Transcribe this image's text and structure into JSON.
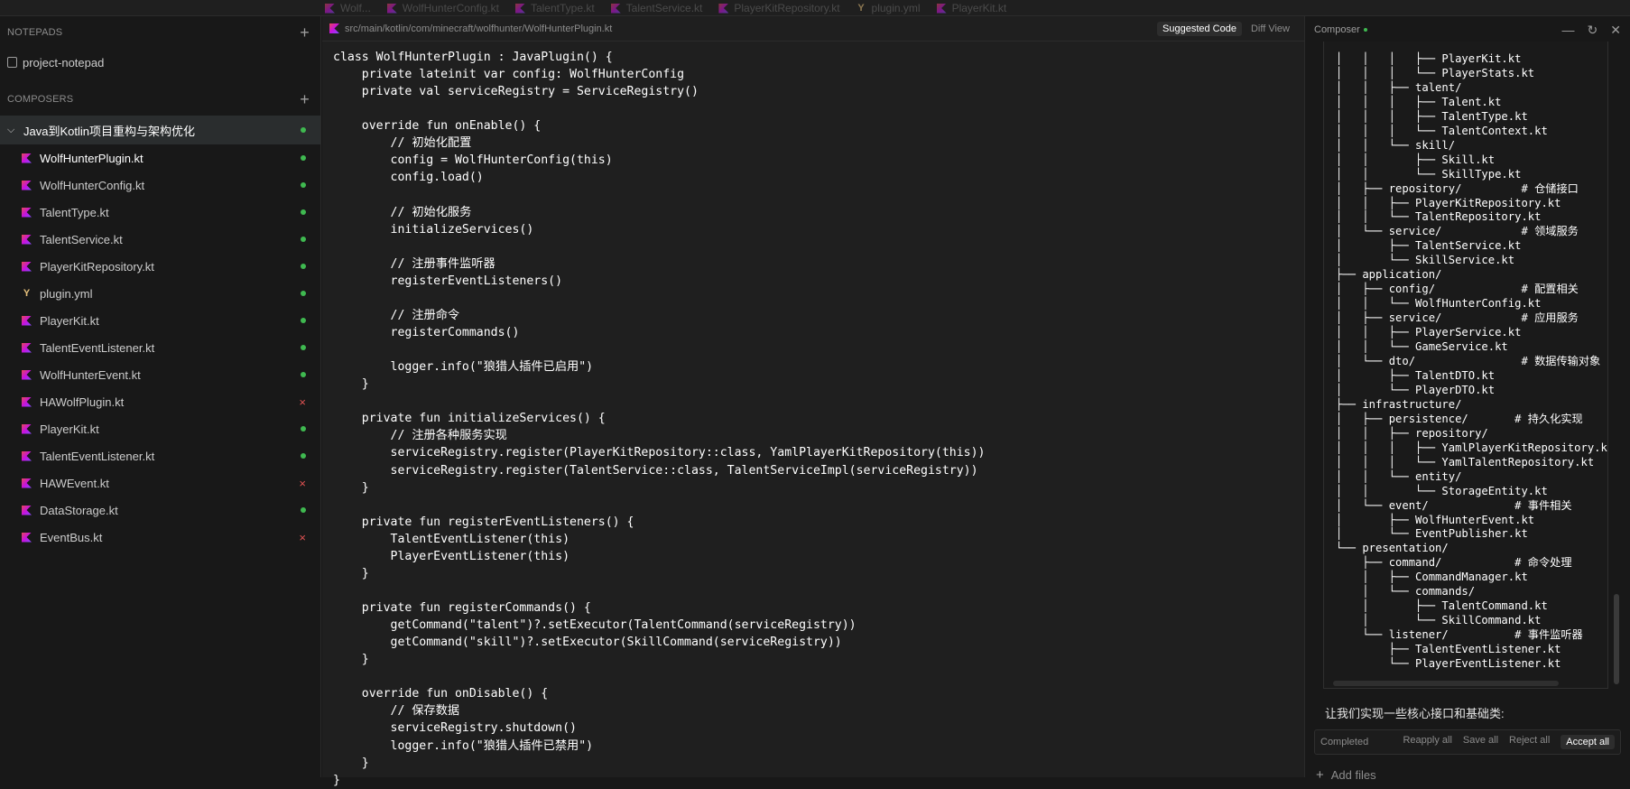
{
  "top_tabs": [
    "Wolf...",
    "WolfHunterConfig.kt",
    "TalentType.kt",
    "TalentService.kt",
    "PlayerKitRepository.kt",
    "plugin.yml",
    "PlayerKit.kt"
  ],
  "sidebar": {
    "notepads_label": "NOTEPADS",
    "notepad_item": "project-notepad",
    "composers_label": "COMPOSERS",
    "composer_title": "Java到Kotlin项目重构与架构优化",
    "files": [
      {
        "name": "WolfHunterPlugin.kt",
        "type": "kt",
        "status": "ok"
      },
      {
        "name": "WolfHunterConfig.kt",
        "type": "kt",
        "status": "ok"
      },
      {
        "name": "TalentType.kt",
        "type": "kt",
        "status": "ok"
      },
      {
        "name": "TalentService.kt",
        "type": "kt",
        "status": "ok"
      },
      {
        "name": "PlayerKitRepository.kt",
        "type": "kt",
        "status": "ok"
      },
      {
        "name": "plugin.yml",
        "type": "yml",
        "status": "ok"
      },
      {
        "name": "PlayerKit.kt",
        "type": "kt",
        "status": "ok"
      },
      {
        "name": "TalentEventListener.kt",
        "type": "kt",
        "status": "ok"
      },
      {
        "name": "WolfHunterEvent.kt",
        "type": "kt",
        "status": "ok"
      },
      {
        "name": "HAWolfPlugin.kt",
        "type": "kt",
        "status": "err"
      },
      {
        "name": "PlayerKit.kt",
        "type": "kt",
        "status": "ok"
      },
      {
        "name": "TalentEventListener.kt",
        "type": "kt",
        "status": "ok"
      },
      {
        "name": "HAWEvent.kt",
        "type": "kt",
        "status": "err"
      },
      {
        "name": "DataStorage.kt",
        "type": "kt",
        "status": "ok"
      },
      {
        "name": "EventBus.kt",
        "type": "kt",
        "status": "err"
      }
    ]
  },
  "editor": {
    "path": "src/main/kotlin/com/minecraft/wolfhunter/WolfHunterPlugin.kt",
    "suggested_label": "Suggested Code",
    "diff_label": "Diff View",
    "code_lines": [
      "class WolfHunterPlugin : JavaPlugin() {",
      "    private lateinit var config: WolfHunterConfig",
      "    private val serviceRegistry = ServiceRegistry()",
      "",
      "    override fun onEnable() {",
      "        // 初始化配置",
      "        config = WolfHunterConfig(this)",
      "        config.load()",
      "",
      "        // 初始化服务",
      "        initializeServices()",
      "",
      "        // 注册事件监听器",
      "        registerEventListeners()",
      "",
      "        // 注册命令",
      "        registerCommands()",
      "",
      "        logger.info(\"狼猎人插件已启用\")",
      "    }",
      "",
      "    private fun initializeServices() {",
      "        // 注册各种服务实现",
      "        serviceRegistry.register(PlayerKitRepository::class, YamlPlayerKitRepository(this))",
      "        serviceRegistry.register(TalentService::class, TalentServiceImpl(serviceRegistry))",
      "    }",
      "",
      "    private fun registerEventListeners() {",
      "        TalentEventListener(this)",
      "        PlayerEventListener(this)",
      "    }",
      "",
      "    private fun registerCommands() {",
      "        getCommand(\"talent\")?.setExecutor(TalentCommand(serviceRegistry))",
      "        getCommand(\"skill\")?.setExecutor(SkillCommand(serviceRegistry))",
      "    }",
      "",
      "    override fun onDisable() {",
      "        // 保存数据",
      "        serviceRegistry.shutdown()",
      "        logger.info(\"狼猎人插件已禁用\")",
      "    }",
      "}"
    ]
  },
  "composer": {
    "title": "Composer",
    "tree_lines": [
      "│   │   │   ├── PlayerKit.kt",
      "│   │   │   └── PlayerStats.kt",
      "│   │   ├── talent/",
      "│   │   │   ├── Talent.kt",
      "│   │   │   ├── TalentType.kt",
      "│   │   │   └── TalentContext.kt",
      "│   │   └── skill/",
      "│   │       ├── Skill.kt",
      "│   │       └── SkillType.kt",
      "│   ├── repository/         # 仓储接口",
      "│   │   ├── PlayerKitRepository.kt",
      "│   │   └── TalentRepository.kt",
      "│   └── service/            # 领域服务",
      "│       ├── TalentService.kt",
      "│       └── SkillService.kt",
      "├── application/",
      "│   ├── config/             # 配置相关",
      "│   │   └── WolfHunterConfig.kt",
      "│   ├── service/            # 应用服务",
      "│   │   ├── PlayerService.kt",
      "│   │   └── GameService.kt",
      "│   └── dto/                # 数据传输对象",
      "│       ├── TalentDTO.kt",
      "│       └── PlayerDTO.kt",
      "├── infrastructure/",
      "│   ├── persistence/       # 持久化实现",
      "│   │   ├── repository/",
      "│   │   │   ├── YamlPlayerKitRepository.k",
      "│   │   │   └── YamlTalentRepository.kt",
      "│   │   └── entity/",
      "│   │       └── StorageEntity.kt",
      "│   └── event/             # 事件相关",
      "│       ├── WolfHunterEvent.kt",
      "│       └── EventPublisher.kt",
      "└── presentation/",
      "    ├── command/           # 命令处理",
      "    │   ├── CommandManager.kt",
      "    │   └── commands/",
      "    │       ├── TalentCommand.kt",
      "    │       └── SkillCommand.kt",
      "    └── listener/          # 事件监听器",
      "        ├── TalentEventListener.kt",
      "        └── PlayerEventListener.kt"
    ],
    "message": "让我们实现一些核心接口和基础类:",
    "status": "Completed",
    "actions": [
      "Reapply all",
      "Save all",
      "Reject all",
      "Accept all"
    ],
    "add_files": "Add files"
  },
  "colors": {
    "ok": "#3fb950",
    "err": "#e05252",
    "accent": "#7f52ff"
  }
}
